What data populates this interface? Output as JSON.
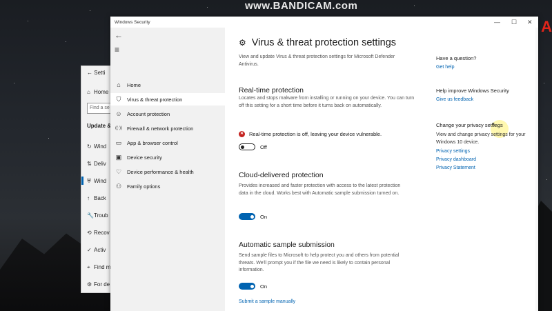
{
  "watermark": "www.BANDICAM.com",
  "corner_mark": "A",
  "background_window": {
    "title": "Setti",
    "items": [
      {
        "icon": "home-icon",
        "label": "Home",
        "glyph": "⌂"
      },
      {
        "icon": "search-icon",
        "label": "Find a se",
        "glyph": ""
      },
      {
        "icon": "",
        "label": "Update &",
        "glyph": ""
      },
      {
        "icon": "refresh-icon",
        "label": "Wind",
        "glyph": "↻"
      },
      {
        "icon": "delivery-icon",
        "label": "Deliv",
        "glyph": "⇅"
      },
      {
        "icon": "shield-icon",
        "label": "Wind",
        "glyph": "⛨"
      },
      {
        "icon": "backup-icon",
        "label": "Back",
        "glyph": "↑"
      },
      {
        "icon": "wrench-icon",
        "label": "Troub",
        "glyph": "🔧"
      },
      {
        "icon": "recovery-icon",
        "label": "Recov",
        "glyph": "⟲"
      },
      {
        "icon": "check-icon",
        "label": "Activ",
        "glyph": "✓"
      },
      {
        "icon": "find-icon",
        "label": "Find m",
        "glyph": "⌖"
      },
      {
        "icon": "dev-icon",
        "label": "For de",
        "glyph": "⚙"
      }
    ]
  },
  "window": {
    "title": "Windows Security",
    "controls": {
      "minimize": "—",
      "maximize": "☐",
      "close": "✕"
    }
  },
  "sidebar": {
    "back_glyph": "←",
    "menu_glyph": "≡",
    "items": [
      {
        "icon": "home-icon",
        "glyph": "⌂",
        "label": "Home"
      },
      {
        "icon": "shield-icon",
        "glyph": "⛉",
        "label": "Virus & threat protection"
      },
      {
        "icon": "account-icon",
        "glyph": "☺",
        "label": "Account protection"
      },
      {
        "icon": "wifi-icon",
        "glyph": "((·))",
        "label": "Firewall & network protection"
      },
      {
        "icon": "app-browser-icon",
        "glyph": "▭",
        "label": "App & browser control"
      },
      {
        "icon": "device-security-icon",
        "glyph": "▣",
        "label": "Device security"
      },
      {
        "icon": "heart-icon",
        "glyph": "♡",
        "label": "Device performance & health"
      },
      {
        "icon": "family-icon",
        "glyph": "⚇",
        "label": "Family options"
      }
    ]
  },
  "main": {
    "title": "Virus & threat protection settings",
    "subtitle": "View and update Virus & threat protection settings for Microsoft Defender Antivirus.",
    "realtime": {
      "heading": "Real-time protection",
      "desc": "Locates and stops malware from installing or running on your device. You can turn off this setting for a short time before it turns back on automatically.",
      "warning": "Real-time protection is off, leaving your device vulnerable.",
      "toggle_state": "Off"
    },
    "cloud": {
      "heading": "Cloud-delivered protection",
      "desc": "Provides increased and faster protection with access to the latest protection data in the cloud. Works best with Automatic sample submission turned on.",
      "toggle_state": "On"
    },
    "sample": {
      "heading": "Automatic sample submission",
      "desc": "Send sample files to Microsoft to help protect you and others from potential threats. We'll prompt you if the file we need is likely to contain personal information.",
      "toggle_state": "On",
      "link": "Submit a sample manually"
    }
  },
  "right_panel": {
    "question": {
      "heading": "Have a question?",
      "link": "Get help"
    },
    "improve": {
      "heading": "Help improve Windows Security",
      "link": "Give us feedback"
    },
    "privacy": {
      "heading": "Change your privacy settings",
      "desc": "View and change privacy settings for your Windows 10 device.",
      "links": [
        "Privacy settings",
        "Privacy dashboard",
        "Privacy Statement"
      ]
    }
  },
  "colors": {
    "accent": "#0063b1",
    "error": "#c4221f",
    "sidebar_bg": "#f1f1f1"
  }
}
